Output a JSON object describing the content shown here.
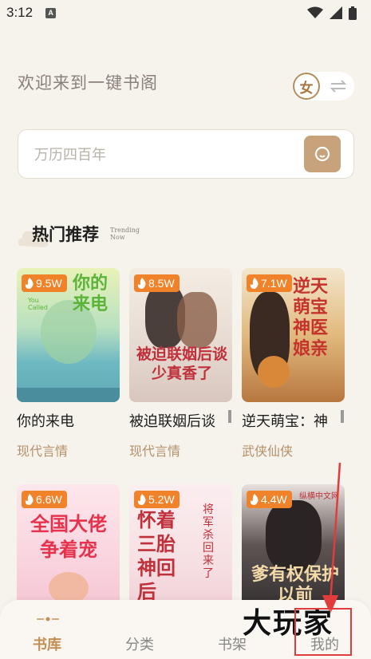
{
  "status_bar": {
    "time": "3:12",
    "notification_badge": "A"
  },
  "header": {
    "welcome": "欢迎来到一键书阁",
    "gender_label": "女"
  },
  "search": {
    "placeholder": "万历四百年"
  },
  "section": {
    "title": "热门推荐",
    "subtitle_line1": "Trending",
    "subtitle_line2": "Now"
  },
  "books": [
    {
      "heat": "9.5W",
      "cover_text": "你的来电",
      "cover_sub": "You Called",
      "title": "你的来电",
      "genre": "现代言情"
    },
    {
      "heat": "8.5W",
      "cover_text": "被迫联姻后谈少真香了",
      "title": "被迫联姻后谈",
      "genre": "现代言情"
    },
    {
      "heat": "7.1W",
      "cover_text": "逆天萌宝神医娘亲",
      "title": "逆天萌宝：神",
      "genre": "武侠仙侠"
    },
    {
      "heat": "6.6W",
      "cover_text": "全国大佬争着宠",
      "title": "",
      "genre": ""
    },
    {
      "heat": "5.2W",
      "cover_text": "怀着三胎神回后",
      "cover_sub": "将军杀回来了",
      "title": "",
      "genre": ""
    },
    {
      "heat": "4.4W",
      "cover_text": "爹有权保护以前",
      "cover_sub": "纵横中文网",
      "title": "",
      "genre": ""
    }
  ],
  "nav": {
    "items": [
      {
        "label": "书库"
      },
      {
        "label": "分类"
      },
      {
        "label": "书架"
      },
      {
        "label": "我的"
      }
    ]
  },
  "watermark": "大玩家",
  "colors": {
    "accent": "#c28f55",
    "badge": "#f0822a",
    "search_button": "#c7a27a",
    "highlight": "#e23b3b"
  }
}
